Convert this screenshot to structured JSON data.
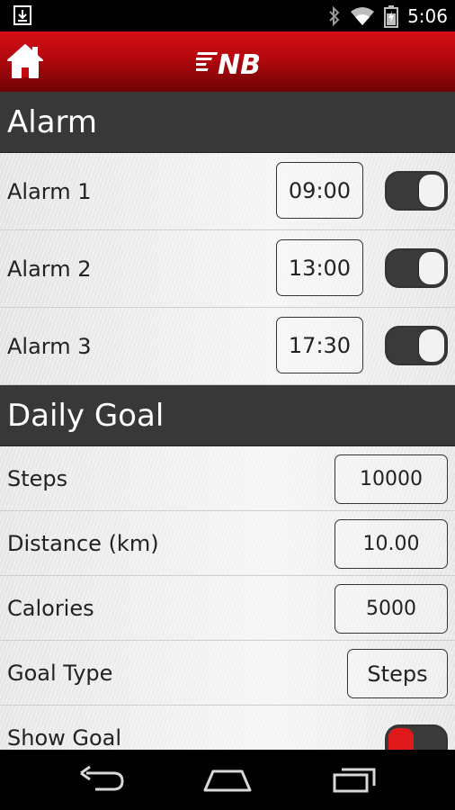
{
  "status_bar": {
    "time": "5:06",
    "icons": [
      "download-notification-icon",
      "bluetooth-icon",
      "wifi-icon",
      "battery-icon"
    ]
  },
  "app_bar": {
    "home_icon": "home-icon",
    "logo": "new-balance-logo",
    "logo_text": "NB"
  },
  "alarm_section": {
    "title": "Alarm",
    "alarms": [
      {
        "label": "Alarm 1",
        "time": "09:00"
      },
      {
        "label": "Alarm 2",
        "time": "13:00"
      },
      {
        "label": "Alarm 3",
        "time": "17:30"
      }
    ]
  },
  "goal_section": {
    "title": "Daily Goal",
    "steps": {
      "label": "Steps",
      "value": "10000"
    },
    "distance": {
      "label": "Distance (km)",
      "value": "10.00"
    },
    "calories": {
      "label": "Calories",
      "value": "5000"
    },
    "goal_type": {
      "label": "Goal Type",
      "value": "Steps"
    },
    "show_goal": {
      "label": "Show Goal"
    }
  },
  "nav_bar": {
    "icons": [
      "back-icon",
      "home-nav-icon",
      "recent-apps-icon"
    ]
  },
  "colors": {
    "brand_red": "#c40a10",
    "section_header": "#383838",
    "toggle_on": "#e01a1a"
  }
}
